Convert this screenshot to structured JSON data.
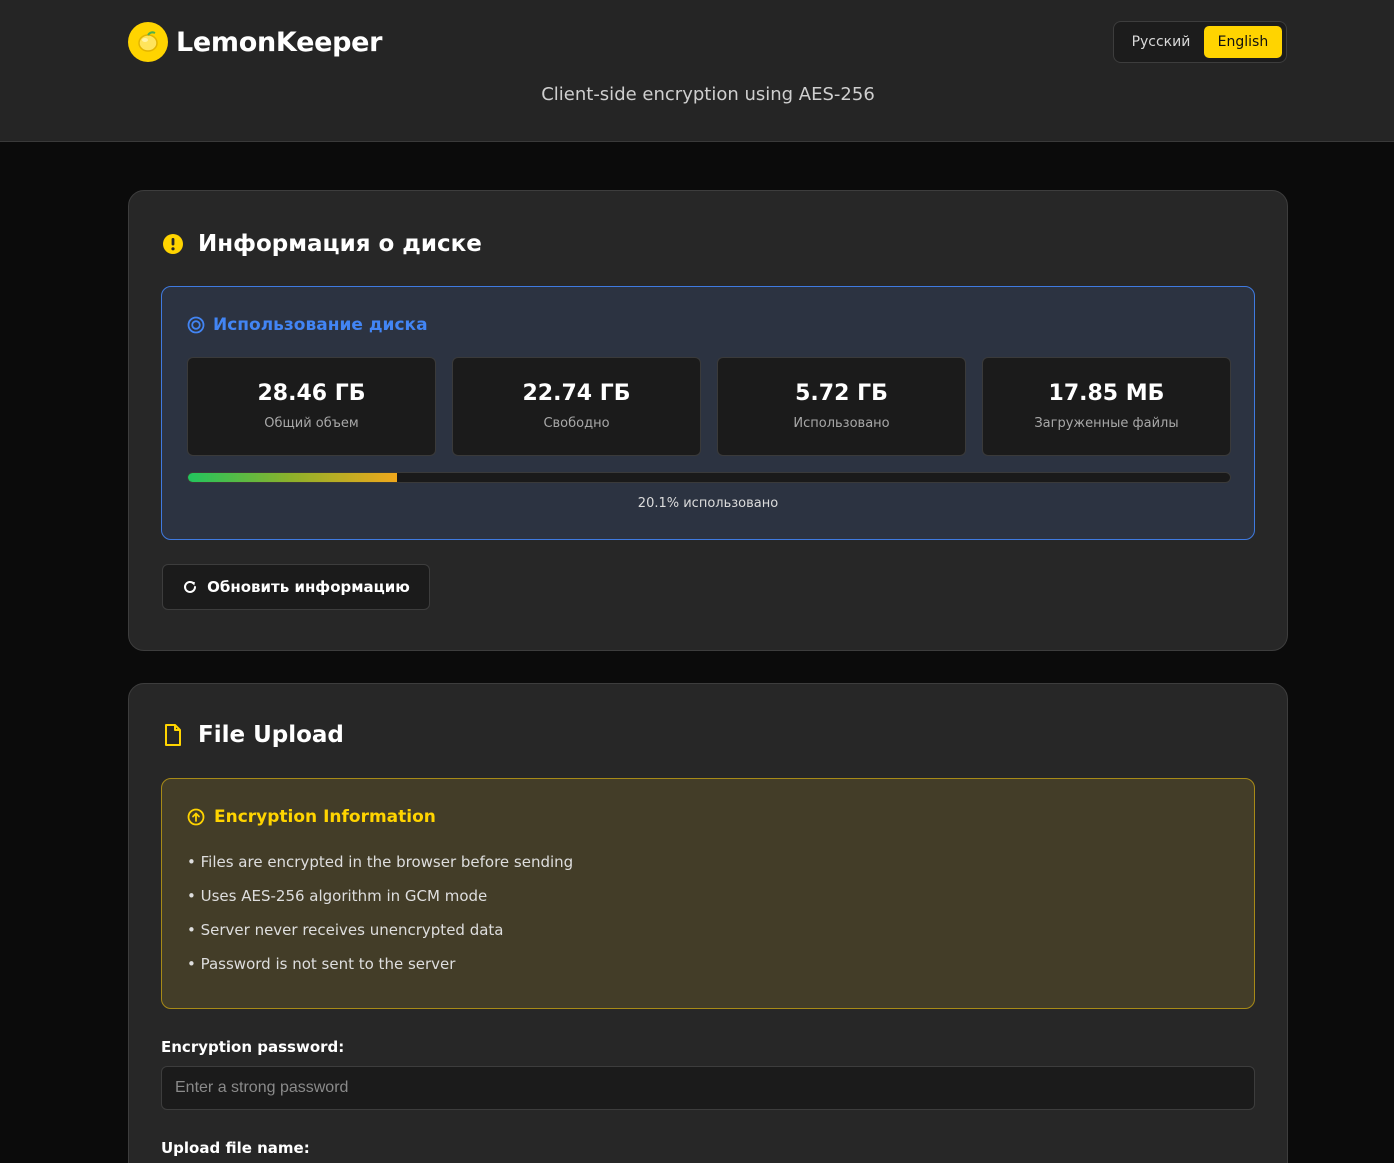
{
  "header": {
    "app_name": "LemonKeeper",
    "subtitle": "Client-side encryption using AES-256",
    "languages": {
      "ru": "Русский",
      "en": "English",
      "active": "en"
    }
  },
  "disk_card": {
    "title": "Информация о диске",
    "usage": {
      "title": "Использование диска",
      "stats": [
        {
          "value": "28.46 ГБ",
          "label": "Общий объем"
        },
        {
          "value": "22.74 ГБ",
          "label": "Свободно"
        },
        {
          "value": "5.72 ГБ",
          "label": "Использовано"
        },
        {
          "value": "17.85 МБ",
          "label": "Загруженные файлы"
        }
      ],
      "percent_used": 20.1,
      "percent_label": "20.1% использовано"
    },
    "refresh_label": "Обновить информацию"
  },
  "upload_card": {
    "title": "File Upload",
    "encryption_info": {
      "title": "Encryption Information",
      "items": [
        "• Files are encrypted in the browser before sending",
        "• Uses AES-256 algorithm in GCM mode",
        "• Server never receives unencrypted data",
        "• Password is not sent to the server"
      ]
    },
    "password_label": "Encryption password:",
    "password_placeholder": "Enter a strong password",
    "password_value": "",
    "filename_label": "Upload file name:"
  },
  "colors": {
    "accent": "#ffd400",
    "info_blue": "#4285f4",
    "background": "#0b0b0b",
    "card": "#272727"
  },
  "icons": {
    "logo": "lemon-icon",
    "disk_title": "alert-circle-icon",
    "usage_title": "target-icon",
    "refresh": "refresh-icon",
    "upload_title": "file-icon",
    "encryption_title": "upload-circle-icon"
  }
}
